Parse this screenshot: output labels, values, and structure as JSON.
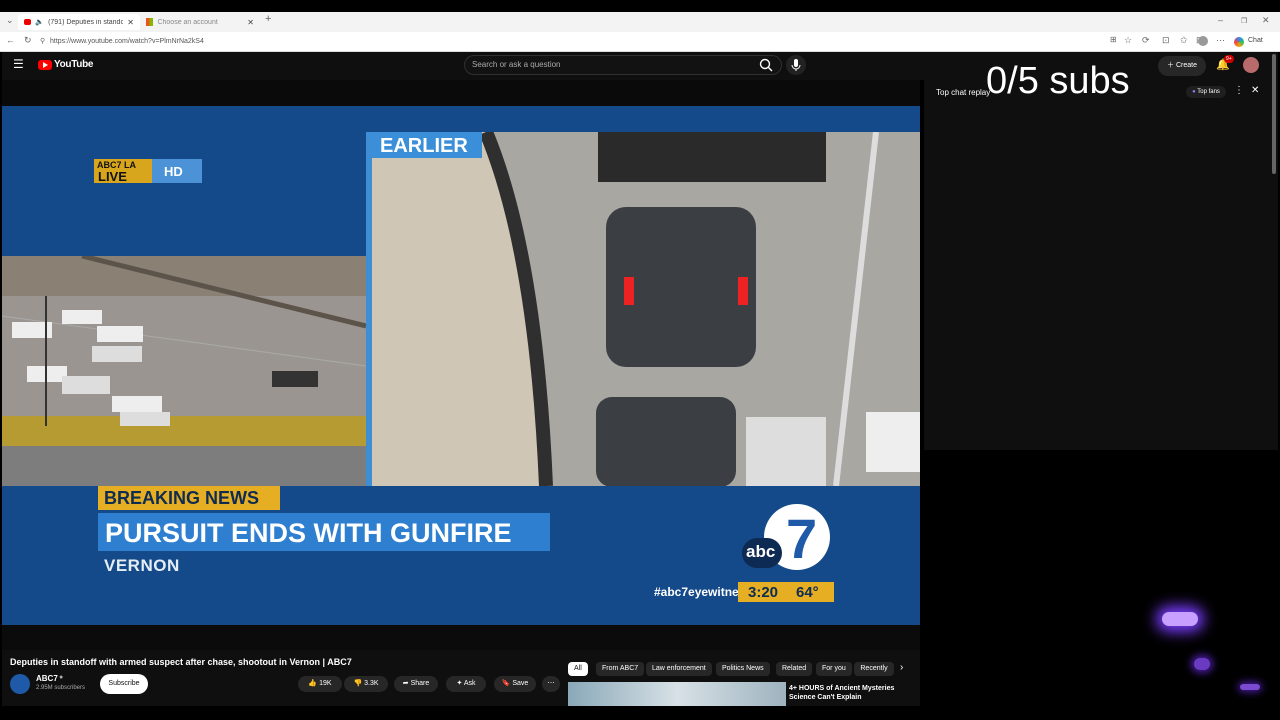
{
  "browser": {
    "tabs": [
      {
        "label": "(791) Deputies in standoff wi",
        "active": true
      },
      {
        "label": "Choose an account",
        "active": false
      }
    ],
    "url": "https://www.youtube.com/watch?v=PlmNrNa2kS4",
    "chat_button": "Chat"
  },
  "youtube": {
    "logo": "YouTube",
    "search_placeholder": "Search or ask a question",
    "create_label": "Create",
    "notifications_badge": "9+"
  },
  "overlay": {
    "subs_counter": "0/5 subs"
  },
  "video_frame": {
    "station_logo": "ABC7 LA",
    "live_label": "LIVE",
    "hd_label": "HD",
    "earlier_label": "EARLIER",
    "breaking_label": "BREAKING NEWS",
    "headline": "PURSUIT ENDS WITH GUNFIRE",
    "location": "VERNON",
    "hashtag": "#abc7eyewitness",
    "time": "3:20",
    "temperature": "64°",
    "abc_logo_text": "abc",
    "abc_logo_number": "7"
  },
  "chat": {
    "title": "Top chat replay",
    "top_fans_label": "Top fans"
  },
  "video_info": {
    "title": "Deputies in standoff with armed suspect after chase, shootout in Vernon | ABC7",
    "channel": "ABC7",
    "subscribers": "2.95M subscribers",
    "subscribe_label": "Subscribe",
    "likes": "19K",
    "dislikes": "3.3K",
    "share_label": "Share",
    "ask_label": "Ask",
    "save_label": "Save"
  },
  "recommendations": {
    "chips": [
      "All",
      "From ABC7",
      "Law enforcement",
      "Politics News",
      "Related",
      "For you",
      "Recently"
    ],
    "first_title": "4+ HOURS of Ancient Mysteries Science Can't Explain"
  }
}
